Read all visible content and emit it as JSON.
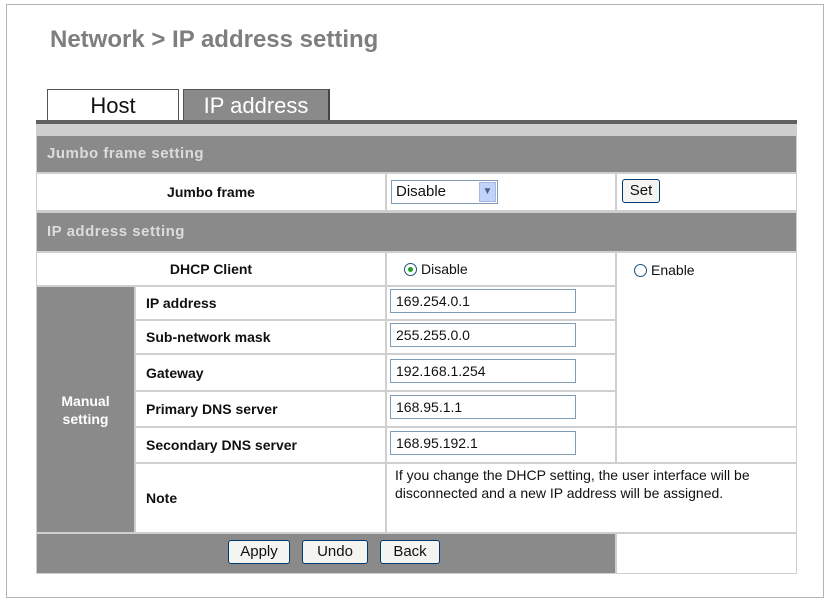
{
  "page": {
    "title": "Network > IP address setting"
  },
  "tabs": [
    {
      "label": "Host"
    },
    {
      "label": "IP address"
    }
  ],
  "jumbo": {
    "section_title": "Jumbo frame setting",
    "label": "Jumbo frame",
    "value": "Disable",
    "set_label": "Set"
  },
  "ip": {
    "section_title": "IP address setting",
    "dhcp_label": "DHCP Client",
    "dhcp_disable": "Disable",
    "dhcp_enable": "Enable",
    "dhcp_selected": "Disable",
    "manual_label": "Manual setting",
    "fields": [
      {
        "label": "IP address",
        "value": "169.254.0.1"
      },
      {
        "label": "Sub-network mask",
        "value": "255.255.0.0"
      },
      {
        "label": "Gateway",
        "value": "192.168.1.254"
      },
      {
        "label": "Primary DNS server",
        "value": "168.95.1.1"
      },
      {
        "label": "Secondary DNS server",
        "value": "168.95.192.1"
      }
    ],
    "note_label": "Note",
    "note_text": "If you change the DHCP setting, the user interface will be disconnected and a new IP address will be assigned."
  },
  "actions": {
    "apply": "Apply",
    "undo": "Undo",
    "back": "Back"
  },
  "colors": {
    "section_bg": "#8a8a8a",
    "grid": "#cfcfcf",
    "radio_dot": "#21a121",
    "title": "#7e7e7e"
  }
}
